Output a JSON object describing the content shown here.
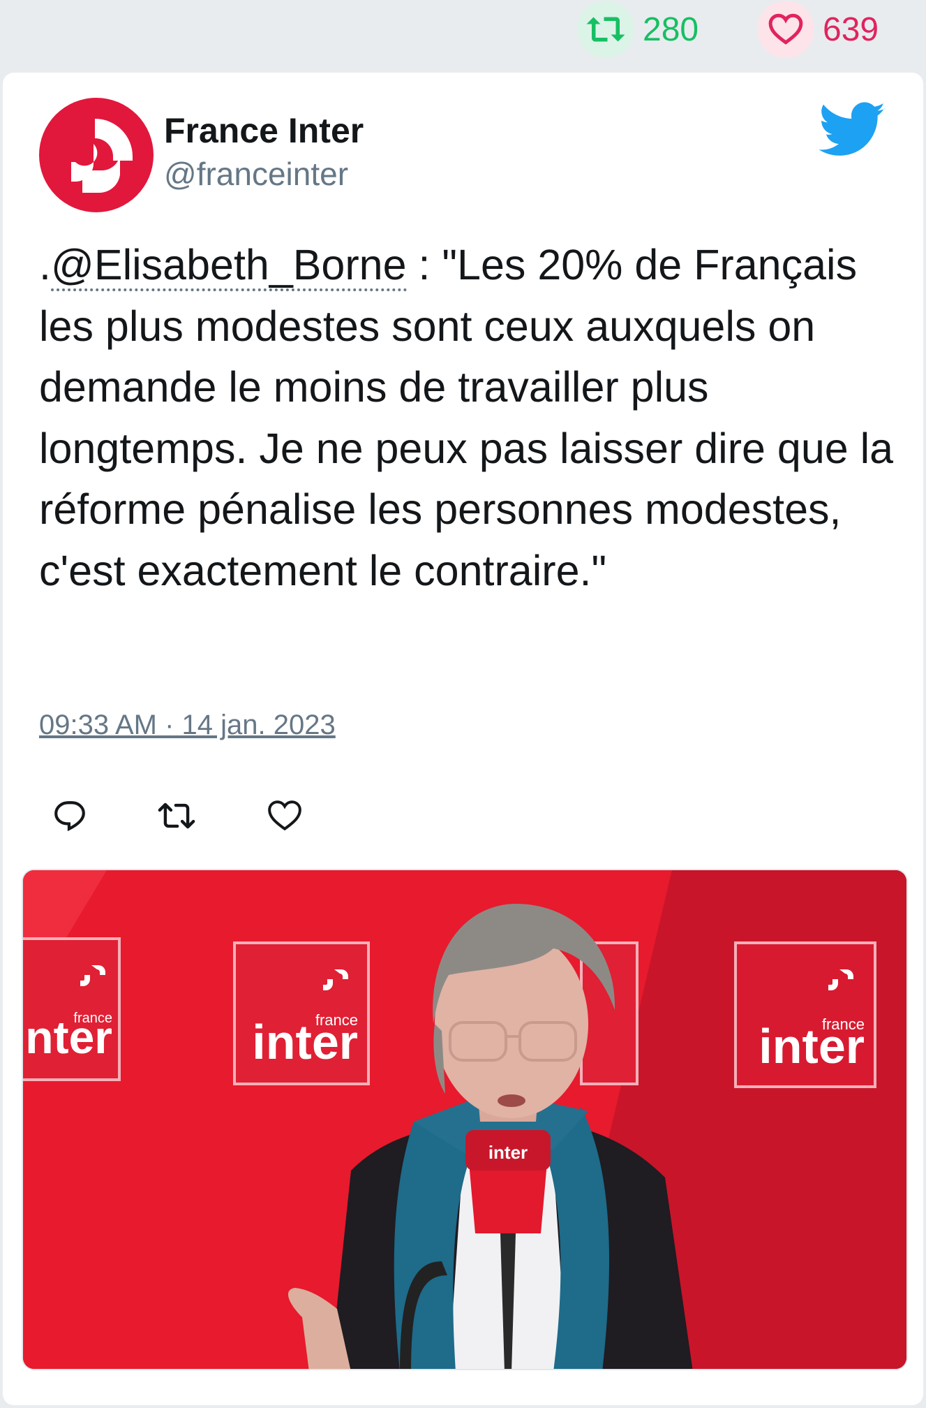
{
  "stats": {
    "retweets": "280",
    "likes": "639"
  },
  "author": {
    "name": "France Inter",
    "handle": "@franceinter"
  },
  "tweet": {
    "prefix": ".",
    "mention": "@Elisabeth_Borne",
    "text": " : \"Les 20% de Français les plus modestes sont ceux auxquels on demande le moins de travailler plus longtemps. Je ne peux pas laisser dire que la réforme pénalise les personnes modestes, c'est exactement le contraire.\"",
    "timestamp": "09:33 AM · 14 jan. 2023"
  },
  "media": {
    "logo_small": "france",
    "logo_big": "inter",
    "mic_label": "inter"
  },
  "colors": {
    "brand_red": "#e2173c",
    "retweet_green": "#17bf63",
    "like_pink": "#e0245e",
    "twitter_blue": "#1da1f2",
    "muted": "#657786"
  },
  "icons": {
    "retweet": "retweet-icon",
    "like": "heart-icon",
    "reply": "reply-icon",
    "bird": "twitter-bird-icon"
  }
}
